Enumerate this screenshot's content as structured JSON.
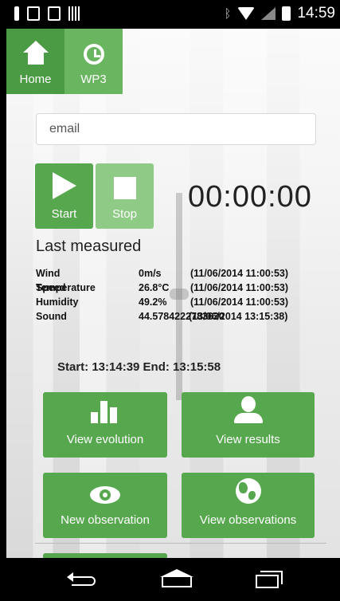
{
  "status_bar": {
    "time": "14:59",
    "icons": [
      "usb-debug-icon",
      "clipboard-check-icon",
      "clipboard-icon",
      "barcode-icon",
      "bluetooth-icon",
      "wifi-icon",
      "signal-icon",
      "battery-charging-icon"
    ]
  },
  "tabs": [
    {
      "label": "Home",
      "icon": "home-icon"
    },
    {
      "label": "WP3",
      "icon": "clock-icon"
    }
  ],
  "email": {
    "placeholder": "email",
    "value": ""
  },
  "controls": {
    "start_label": "Start",
    "stop_label": "Stop",
    "timer": "00:00:00"
  },
  "last_measured": {
    "title": "Last measured",
    "rows": [
      {
        "label": "Wind Speed",
        "value": "0m/s",
        "timestamp": "(11/06/2014 11:00:53)"
      },
      {
        "label": "Temperature",
        "value": "26.8°C",
        "timestamp": "(11/06/2014 11:00:53)"
      },
      {
        "label": "Humidity",
        "value": "49.2%",
        "timestamp": "(11/06/2014 11:00:53)"
      },
      {
        "label": "Sound",
        "value": "44.5784222783630",
        "timestamp": "(13/06/2014 13:15:38)"
      }
    ]
  },
  "session": {
    "text": "Start: 13:14:39 End: 13:15:58"
  },
  "actions": [
    {
      "label": "View evolution",
      "icon": "bar-chart-icon"
    },
    {
      "label": "View results",
      "icon": "user-icon"
    },
    {
      "label": "New observation",
      "icon": "eye-icon"
    },
    {
      "label": "View observations",
      "icon": "globe-icon"
    }
  ],
  "colors": {
    "green": "#56a74d",
    "green_light": "#8fcb86",
    "text": "#222222"
  }
}
